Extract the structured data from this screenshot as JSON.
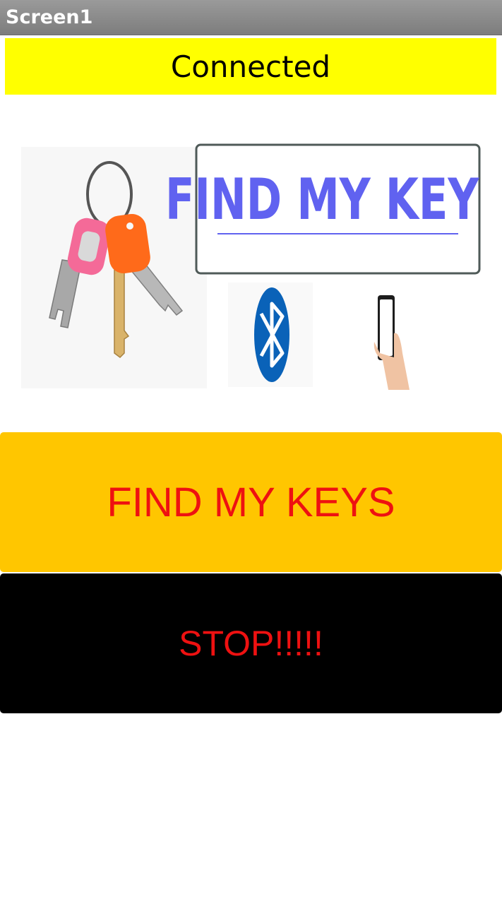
{
  "app": {
    "title": "Screen1"
  },
  "status": {
    "text": "Connected",
    "background": "#ffff00"
  },
  "banner": {
    "logo_text": "FIND MY KEYS",
    "icons": [
      "bluetooth-icon",
      "keys-image",
      "bluetooth-icon",
      "phone-in-hand-image"
    ]
  },
  "buttons": {
    "find_label": "FIND MY KEYS",
    "find_background": "#ffc600",
    "stop_label": "STOP!!!!!",
    "stop_background": "#000000",
    "label_color": "#ee1111"
  }
}
